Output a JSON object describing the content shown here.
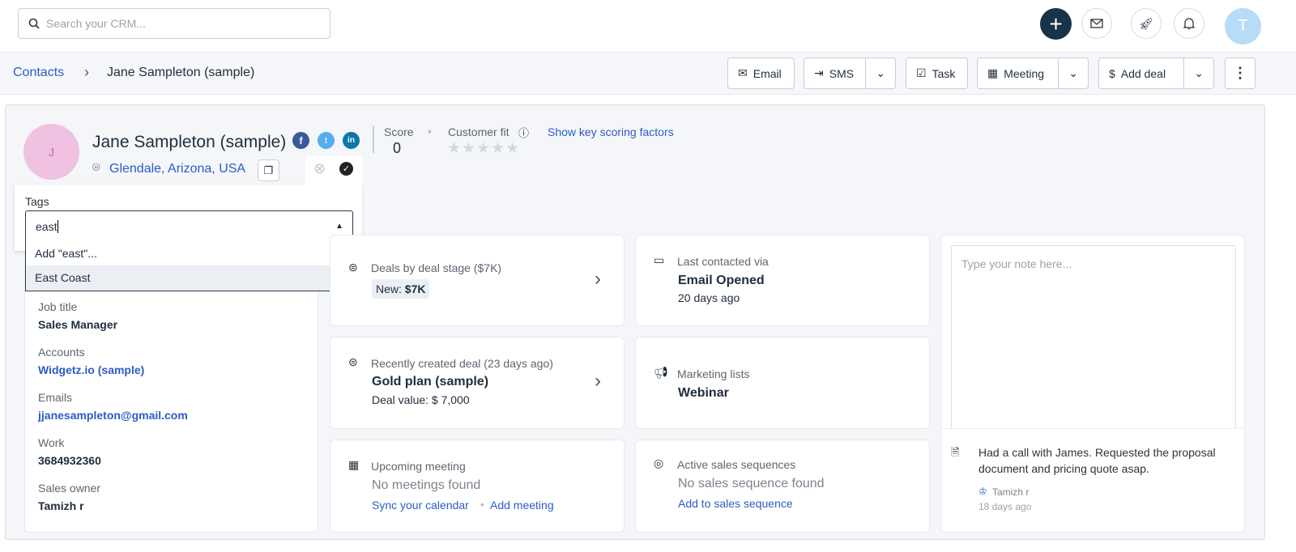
{
  "topbar": {
    "search_placeholder": "Search your CRM...",
    "avatar_initial": "T"
  },
  "breadcrumb": {
    "parent": "Contacts",
    "current": "Jane Sampleton (sample)"
  },
  "actions": {
    "email": "Email",
    "sms": "SMS",
    "task": "Task",
    "meeting": "Meeting",
    "add_deal": "Add deal"
  },
  "contact": {
    "initial": "J",
    "name": "Jane Sampleton (sample)",
    "location": "Glendale, Arizona, USA",
    "score_label": "Score",
    "score": "0",
    "fit_label": "Customer fit",
    "scoring_link": "Show key scoring factors"
  },
  "tags": {
    "label": "Tags",
    "value": "east",
    "options": [
      "Add \"east\"...",
      "East Coast"
    ]
  },
  "details": [
    {
      "label": "Job title",
      "value": "Sales Manager",
      "link": false
    },
    {
      "label": "Accounts",
      "value": "Widgetz.io (sample)",
      "link": true
    },
    {
      "label": "Emails",
      "value": "jjanesampleton@gmail.com",
      "link": true
    },
    {
      "label": "Work",
      "value": "3684932360",
      "link": false
    },
    {
      "label": "Sales owner",
      "value": "Tamizh r",
      "link": false
    }
  ],
  "cards": {
    "deals_stage": {
      "title": "Deals by deal stage ($7K)",
      "badge_label": "New:",
      "badge_value": "$7K"
    },
    "recent_deal": {
      "title": "Recently created deal (23 days ago)",
      "name": "Gold plan (sample)",
      "value": "Deal value: $ 7,000"
    },
    "meeting": {
      "title": "Upcoming meeting",
      "empty": "No meetings found",
      "sync": "Sync your calendar",
      "add": "Add meeting"
    },
    "last_contacted": {
      "title": "Last contacted via",
      "value": "Email Opened",
      "time": "20 days ago"
    },
    "marketing": {
      "title": "Marketing lists",
      "value": "Webinar"
    },
    "sequences": {
      "title": "Active sales sequences",
      "empty": "No sales sequence found",
      "add": "Add to sales sequence"
    }
  },
  "notes": {
    "placeholder": "Type your note here...",
    "text": "Had a call with James. Requested the proposal document and pricing quote asap.",
    "author": "Tamizh r",
    "time": "18 days ago"
  }
}
